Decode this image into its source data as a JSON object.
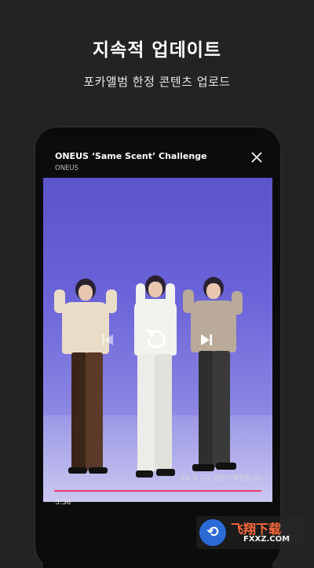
{
  "promo": {
    "headline": "지속적 업데이트",
    "subline": "포카앨범 한정 콘텐츠 업로드"
  },
  "player": {
    "title": "ONEUS ‘Same Scent’ Challenge",
    "artist": "ONEUS",
    "countdown": "3초 후 다음 영상이 재생됩니다.",
    "time": "3:36",
    "progress": 1.0,
    "progress_color": "#e83b6a"
  },
  "icons": {
    "close": "close-icon",
    "previous": "skip-previous-icon",
    "replay": "replay-icon",
    "next": "skip-next-icon"
  },
  "watermark": {
    "name": "飞翔下载",
    "url": "FXXZ.COM"
  }
}
